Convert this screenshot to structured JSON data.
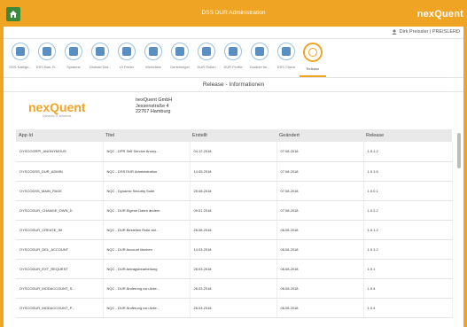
{
  "header": {
    "title": "DSS DUR Administration",
    "brand": "nexQuent"
  },
  "user": {
    "name": "Dirk Preissler | PREISLERD"
  },
  "toolbar": [
    {
      "label": "DSS Katego...",
      "icon": "target-icon"
    },
    {
      "label": "DSS Bas..R...",
      "icon": "document-icon"
    },
    {
      "label": "Systeme",
      "icon": "phone-icon"
    },
    {
      "label": "Globale Dat...",
      "icon": "refresh-icon"
    },
    {
      "label": "UI Felder",
      "icon": "form-icon"
    },
    {
      "label": "Werteliste",
      "icon": "copy-icon"
    },
    {
      "label": "Genehmiger",
      "icon": "user-icon"
    },
    {
      "label": "DUR Rollen",
      "icon": "list-icon"
    },
    {
      "label": "DUR Profile",
      "icon": "list-icon"
    },
    {
      "label": "Zusätze für...",
      "icon": "mail-icon"
    },
    {
      "label": "DSS Check",
      "icon": "checklist-icon"
    },
    {
      "label": "Release",
      "icon": "circle-icon"
    }
  ],
  "section": {
    "title": "Release - Informationen"
  },
  "company": {
    "logo": "nexQuent",
    "logo_sub": "Dynamic IT solutions",
    "name": "nexQuent GmbH",
    "street": "Jessenstraße 4",
    "city": "22767 Hamburg"
  },
  "table": {
    "headers": [
      "App Id",
      "Titel",
      "Erstellt",
      "Geändert",
      "Release"
    ],
    "rows": [
      [
        "OYSCOGRPI_ANONYMOUS",
        "NQC - DPR Self Service Anony...",
        "04.12.2018",
        "07.08.2018",
        "1.0.1.2"
      ],
      [
        "OYSCODSS_DUR_ADMIN",
        "NQC - DSS DUR Administration",
        "14.05.2018",
        "07.08.2018",
        "1.0.1.6"
      ],
      [
        "OYSCODSS_MAIN_PAGE",
        "NQC - Dynamic Security Suite",
        "25.08.2018",
        "07.08.2018",
        "1.0.0.1"
      ],
      [
        "OYSCODUR_CHANGE_OWN_D",
        "NQC - DUR Eigene Daten ändern",
        "09.01.2018",
        "07.08.2018",
        "1.0.2.2"
      ],
      [
        "OYSCODUR_CREATE_IM",
        "NQC - DUR Bestellen Rolle anl...",
        "26.08.2018",
        "06.08.2018",
        "1.0.1.2"
      ],
      [
        "OYSCODUR_DEL_ACCOUNT",
        "NQC - DUR Account löschen",
        "14.03.2018",
        "06.08.2018",
        "1.0.1.2"
      ],
      [
        "OYSCODUR_EXT_REQUEST",
        "NQC - DUR Antragsbearbeitung",
        "26.03.2018",
        "06.08.2018",
        "1.0.1"
      ],
      [
        "OYSCODUR_MODACCOUNT_S...",
        "NQC - DUR Änderung von Ante...",
        "26.03.2018",
        "06.08.2018",
        "1.0.4"
      ],
      [
        "OYSCODUR_MODACCOUNT_P...",
        "NQC - DUR Änderung von Ante...",
        "26.03.2018",
        "06.08.2018",
        "1.0.4"
      ]
    ]
  }
}
